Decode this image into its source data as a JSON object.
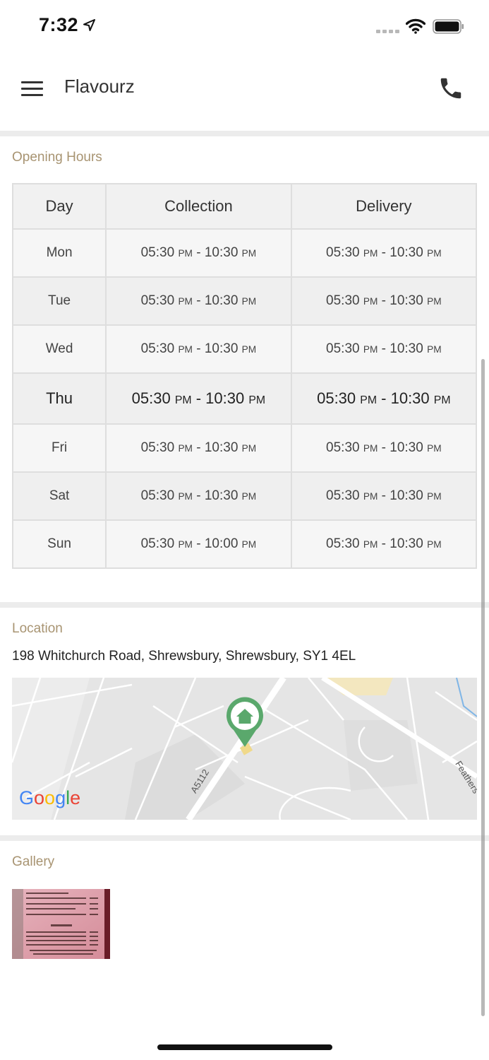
{
  "status_bar": {
    "time": "7:32"
  },
  "header": {
    "title": "Flavourz"
  },
  "opening_hours": {
    "title": "Opening Hours",
    "columns": [
      "Day",
      "Collection",
      "Delivery"
    ],
    "rows": [
      {
        "day": "Mon",
        "collection": {
          "open": "05:30",
          "open_ampm": "PM",
          "close": "10:30",
          "close_ampm": "PM"
        },
        "delivery": {
          "open": "05:30",
          "open_ampm": "PM",
          "close": "10:30",
          "close_ampm": "PM"
        }
      },
      {
        "day": "Tue",
        "collection": {
          "open": "05:30",
          "open_ampm": "PM",
          "close": "10:30",
          "close_ampm": "PM"
        },
        "delivery": {
          "open": "05:30",
          "open_ampm": "PM",
          "close": "10:30",
          "close_ampm": "PM"
        }
      },
      {
        "day": "Wed",
        "collection": {
          "open": "05:30",
          "open_ampm": "PM",
          "close": "10:30",
          "close_ampm": "PM"
        },
        "delivery": {
          "open": "05:30",
          "open_ampm": "PM",
          "close": "10:30",
          "close_ampm": "PM"
        }
      },
      {
        "day": "Thu",
        "collection": {
          "open": "05:30",
          "open_ampm": "PM",
          "close": "10:30",
          "close_ampm": "PM"
        },
        "delivery": {
          "open": "05:30",
          "open_ampm": "PM",
          "close": "10:30",
          "close_ampm": "PM"
        }
      },
      {
        "day": "Fri",
        "collection": {
          "open": "05:30",
          "open_ampm": "PM",
          "close": "10:30",
          "close_ampm": "PM"
        },
        "delivery": {
          "open": "05:30",
          "open_ampm": "PM",
          "close": "10:30",
          "close_ampm": "PM"
        }
      },
      {
        "day": "Sat",
        "collection": {
          "open": "05:30",
          "open_ampm": "PM",
          "close": "10:30",
          "close_ampm": "PM"
        },
        "delivery": {
          "open": "05:30",
          "open_ampm": "PM",
          "close": "10:30",
          "close_ampm": "PM"
        }
      },
      {
        "day": "Sun",
        "collection": {
          "open": "05:30",
          "open_ampm": "PM",
          "close": "10:00",
          "close_ampm": "PM"
        },
        "delivery": {
          "open": "05:30",
          "open_ampm": "PM",
          "close": "10:30",
          "close_ampm": "PM"
        }
      }
    ],
    "separator": " - "
  },
  "location": {
    "title": "Location",
    "address": "198 Whitchurch Road, Shrewsbury, Shrewsbury, SY1 4EL",
    "map": {
      "road_label": "A5112",
      "street_label": "Feathers",
      "logo_text": "Google",
      "marker_icon": "home-icon",
      "marker_color": "#5aa86c"
    }
  },
  "gallery": {
    "title": "Gallery"
  },
  "colors": {
    "section_title": "#a89472",
    "separator": "#ececec",
    "table_border": "#dedede"
  }
}
